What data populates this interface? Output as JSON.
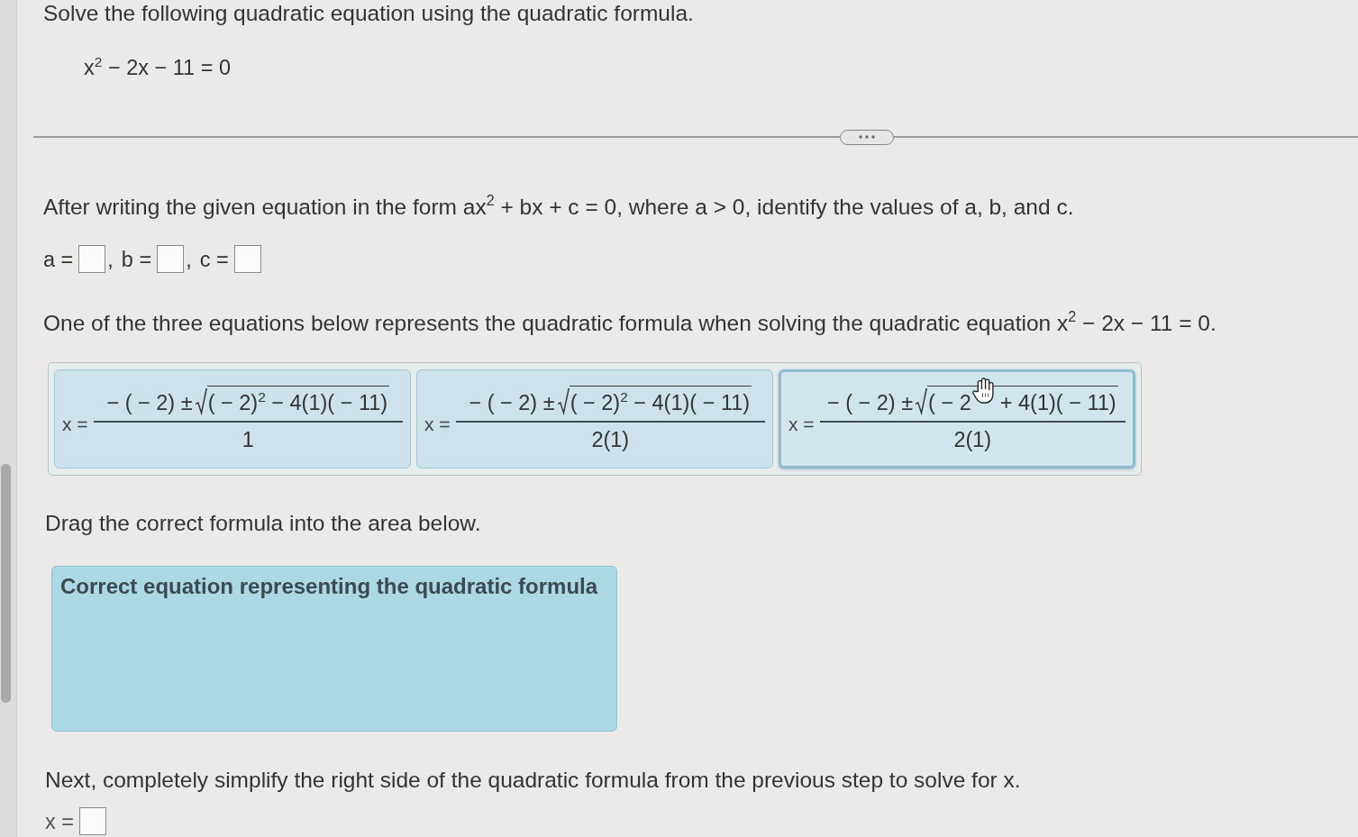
{
  "instruction": "Solve the following quadratic equation using the quadratic formula.",
  "equation": "x$^{2}$ − 2x − 11 = 0",
  "coefficients": {
    "prompt": "After writing the given equation in the form ax$^{2}$ + bx + c = 0, where a > 0, identify the values of a, b, and c.",
    "answers": [
      {
        "label": "a =",
        "separator": ","
      },
      {
        "label": "b =",
        "separator": ","
      },
      {
        "label": "c ="
      }
    ]
  },
  "formula_choice": {
    "prompt": "One of the three equations below represents the quadratic formula when solving the quadratic equation x$^{2}$ − 2x − 11 = 0.",
    "choices": [
      {
        "lhs": "x =",
        "numerator": "− ( − 2) ±",
        "radicand": [
          "( − 2)$^{2}$ − 4(1)( − 11)"
        ],
        "denominator": "1",
        "hovered": false
      },
      {
        "lhs": "x =",
        "numerator": "− ( − 2) ±",
        "radicand": [
          "( − 2)$^{2}$ − 4(1)( − 11)"
        ],
        "denominator": "2(1)",
        "hovered": false
      },
      {
        "lhs": "x =",
        "numerator": "− ( − 2) ±",
        "radicand": [
          "( − 2",
          "+ 4(1)( − 11)"
        ],
        "denominator": "2(1)",
        "hovered": true
      }
    ],
    "instruction": "Drag the correct formula into the area below.",
    "drop_area": {
      "label": "Correct equation representing the quadratic formula"
    }
  },
  "solve": {
    "prompt": "Next, completely simplify the right side of the quadratic formula from the previous step to solve for x.",
    "answer": {
      "label": "x ="
    }
  }
}
